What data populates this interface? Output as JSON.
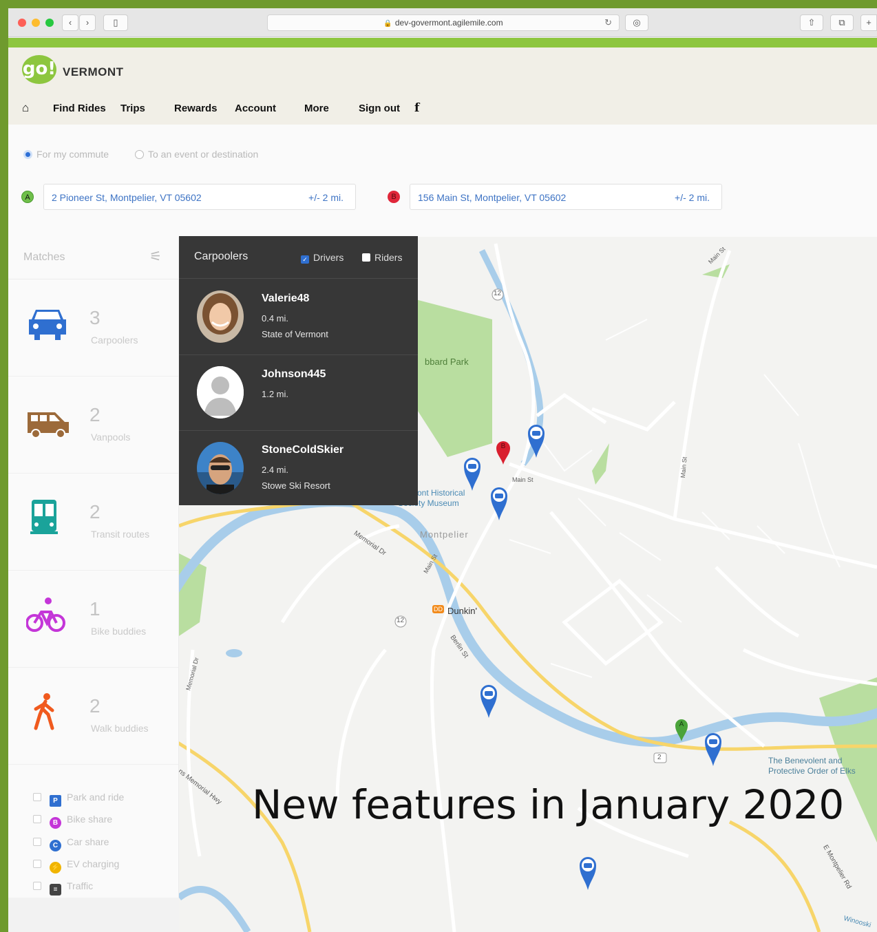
{
  "browser": {
    "url": "dev-govermont.agilemile.com"
  },
  "brand": {
    "logo_text": "go!",
    "name": "VERMONT",
    "accent": "#8dc63f"
  },
  "nav": {
    "items": [
      "Find Rides",
      "Trips",
      "Rewards",
      "Account",
      "More",
      "Sign out"
    ]
  },
  "trip": {
    "option_commute": "For my commute",
    "option_event": "To an event or destination",
    "origin_marker": "A",
    "origin": "2 Pioneer St, Montpelier, VT 05602",
    "origin_radius": "+/- 2 mi.",
    "dest_marker": "B",
    "destination": "156 Main St, Montpelier, VT 05602",
    "dest_radius": "+/- 2 mi."
  },
  "sidebar": {
    "title": "Matches",
    "modes": [
      {
        "count": "3",
        "label": "Carpoolers",
        "icon": "car-icon",
        "color": "#2f6fd0"
      },
      {
        "count": "2",
        "label": "Vanpools",
        "icon": "van-icon",
        "color": "#9c6a3a"
      },
      {
        "count": "2",
        "label": "Transit routes",
        "icon": "bus-icon",
        "color": "#1aa39a"
      },
      {
        "count": "1",
        "label": "Bike buddies",
        "icon": "bike-icon",
        "color": "#c436d8"
      },
      {
        "count": "2",
        "label": "Walk buddies",
        "icon": "walk-icon",
        "color": "#f05a1e"
      }
    ],
    "layers": [
      {
        "badge": "P",
        "label": "Park and ride",
        "color": "#2f6fd0"
      },
      {
        "badge": "B",
        "label": "Bike share",
        "color": "#c436d8"
      },
      {
        "badge": "C",
        "label": "Car share",
        "color": "#2f6fd0"
      },
      {
        "badge": "⚡",
        "label": "EV charging",
        "color": "#f0b400"
      },
      {
        "badge": "≡",
        "label": "Traffic",
        "color": "#444444"
      }
    ]
  },
  "panel": {
    "title": "Carpoolers",
    "drivers_label": "Drivers",
    "riders_label": "Riders",
    "people": [
      {
        "name": "Valerie48",
        "distance": "0.4 mi.",
        "place": "State of Vermont"
      },
      {
        "name": "Johnson445",
        "distance": "1.2 mi.",
        "place": ""
      },
      {
        "name": "StoneColdSkier",
        "distance": "2.4 mi.",
        "place": "Stowe Ski Resort"
      }
    ]
  },
  "map": {
    "labels": {
      "main_st_top": "Main St",
      "hubbard": "bbard Park",
      "main_st_center": "Main St",
      "main_st_right": "Main St",
      "museum": "Vermont Historical Society Museum",
      "montpelier": "Montpelier",
      "memorial_dr": "Memorial Dr",
      "main_st_lower": "Main St",
      "dunkin": "Dunkin'",
      "berlin_st": "Berlin St",
      "memorial_dr_left": "Memorial Dr",
      "vets_hwy": "ns Memorial Hwy",
      "elks": "The Benevolent and Protective Order of Elks",
      "e_montpelier": "E Montpelier Rd",
      "winooski": "Winooski",
      "route12a": "12",
      "route12b": "12",
      "route2": "2"
    },
    "pin_labels": {
      "origin": "A",
      "destination": "B"
    }
  },
  "banner": "New features in January 2020"
}
